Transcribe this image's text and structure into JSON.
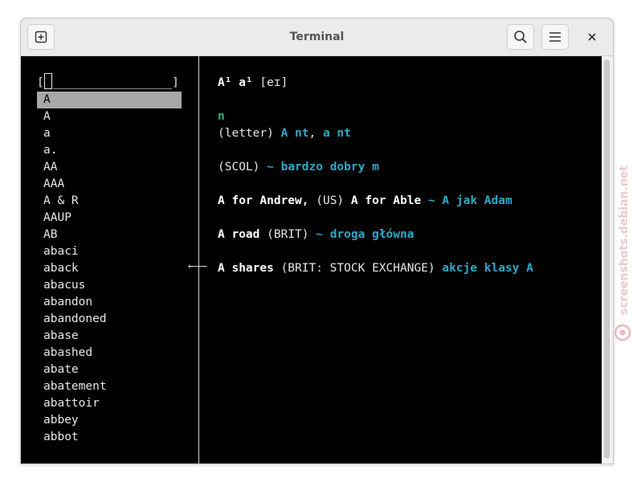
{
  "window": {
    "title": "Terminal"
  },
  "search": {
    "prefix": "[",
    "field": "_________________",
    "suffix": "]"
  },
  "wordlist": [
    "A",
    "A",
    "a",
    "a.",
    "AA",
    "AAA",
    "A & R",
    "AAUP",
    "AB",
    "abaci",
    "aback",
    "abacus",
    "abandon",
    "abandoned",
    "abase",
    "abashed",
    "abate",
    "abatement",
    "abattoir",
    "abbey",
    "abbot"
  ],
  "entry": {
    "headword": "A¹ a¹",
    "pron": "[eɪ]",
    "pos": "n",
    "sense1_label": "(letter)",
    "sense1_t1": "A nt",
    "sense1_sep": ",",
    "sense1_t2": "a nt",
    "sense2_label": "(SCOL)",
    "sense2_tr": "~ bardzo dobry m",
    "phrase1_a": "A for Andrew,",
    "phrase1_b": "(US)",
    "phrase1_c": "A for Able",
    "phrase1_tr": "~ A jak Adam",
    "phrase2_a": "A road",
    "phrase2_b": "(BRIT)",
    "phrase2_tr": "~ droga główna",
    "phrase3_a": "A shares",
    "phrase3_b": "(BRIT: STOCK EXCHANGE)",
    "phrase3_tr": "akcje klasy A"
  },
  "pointer": "←——",
  "watermark": "screenshots.debian.net",
  "colors": {
    "green": "#2fb37a",
    "teal": "#2ea9c7",
    "selection": "#a8a8a8"
  },
  "icons": {
    "new_tab": "new-tab-icon",
    "search": "search-icon",
    "menu": "hamburger-menu-icon",
    "close": "close-icon"
  }
}
